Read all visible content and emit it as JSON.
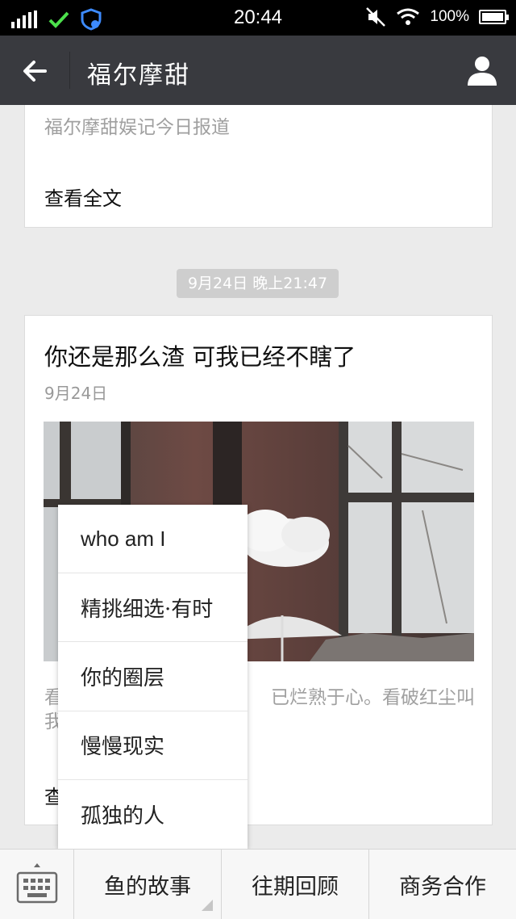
{
  "status_bar": {
    "time": "20:44",
    "battery": "100%",
    "battery_level": 1.0
  },
  "header": {
    "title": "福尔摩甜"
  },
  "messages": [
    {
      "summary": "福尔摩甜娱记今日报道",
      "read_more": "查看全文"
    }
  ],
  "timestamp": "9月24日 晚上21:47",
  "article": {
    "title": "你还是那么渣 可我已经不瞎了",
    "date": "9月24日",
    "summary_visible": "看",
    "summary_right": "已烂熟于心。看破红尘叫",
    "summary_line2": "我",
    "read_more": "查"
  },
  "popup_menu": {
    "items": [
      "who am  I",
      "精挑细选·有时",
      "你的圈层",
      "慢慢现实",
      "孤独的人"
    ]
  },
  "bottom_menu": {
    "items": [
      "鱼的故事",
      "往期回顾",
      "商务合作"
    ]
  },
  "colors": {
    "status_bg": "#000000",
    "header_bg": "#393a3f",
    "page_bg": "#ebebeb",
    "card_bg": "#ffffff",
    "check_green": "#4ce04c",
    "shield_blue": "#3d8bff"
  },
  "icons": {
    "back": "arrow-left-icon",
    "profile": "person-icon",
    "keyboard": "keyboard-icon",
    "signal": "signal-icon",
    "check": "check-icon",
    "shield": "shield-icon",
    "mute": "mute-icon",
    "wifi": "wifi-icon",
    "battery": "battery-icon"
  }
}
